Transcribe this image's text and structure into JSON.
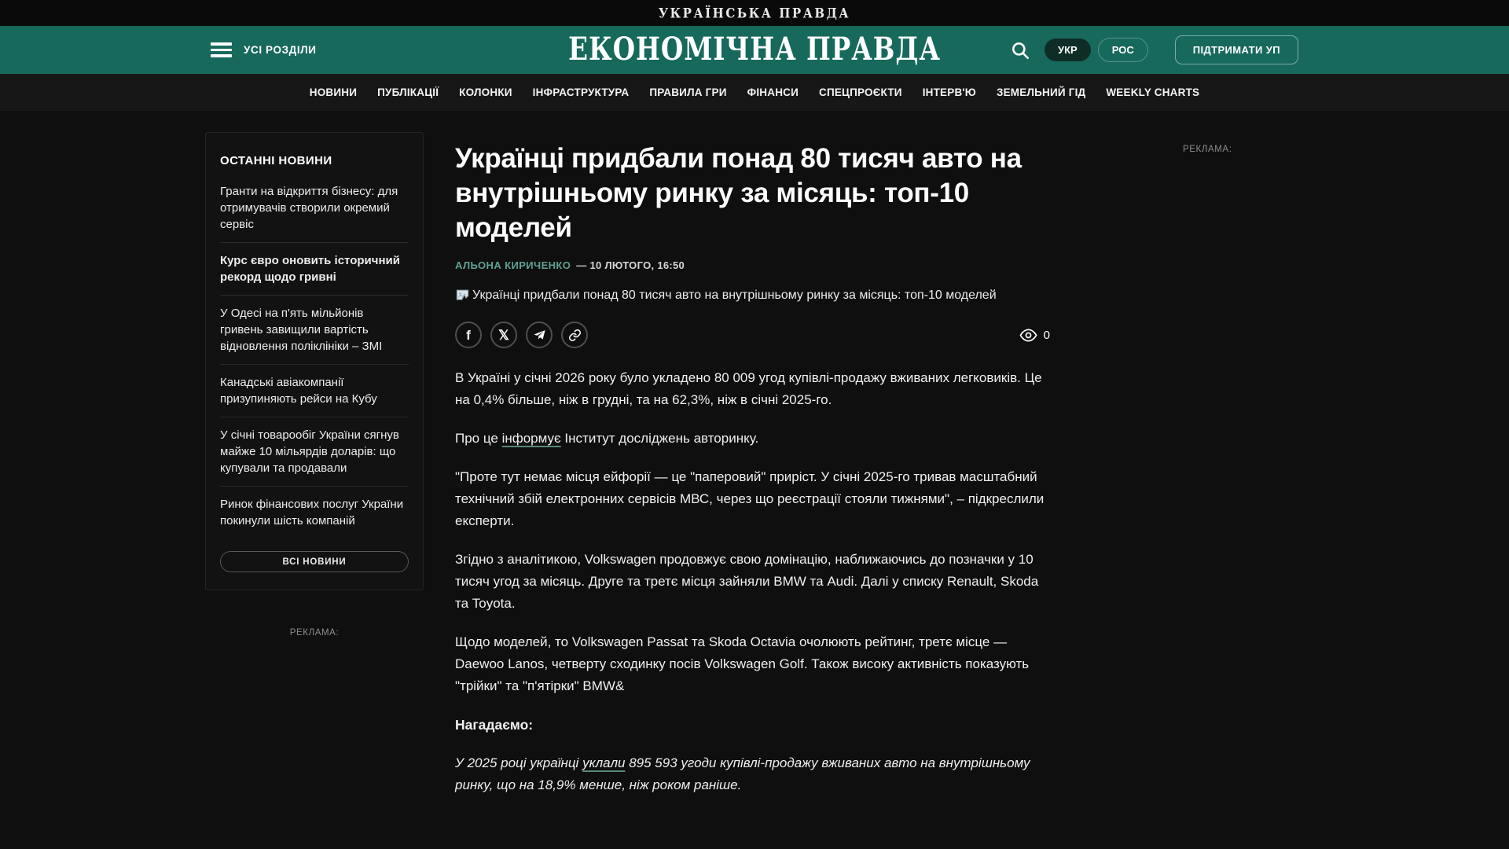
{
  "topbar": {
    "brand": "УКРАЇНСЬКА ПРАВДА"
  },
  "header": {
    "menu_label": "УСІ РОЗДІЛИ",
    "logo": "ЕКОНОМІЧНА ПРАВДА",
    "language_toggle": {
      "options": [
        {
          "label": "УКР",
          "active": true
        },
        {
          "label": "РОС",
          "active": false
        }
      ]
    },
    "support_button": "ПІДТРИМАТИ УП"
  },
  "nav": {
    "items": [
      "НОВИНИ",
      "ПУБЛІКАЦІЇ",
      "КОЛОНКИ",
      "ІНФРАСТРУКТУРА",
      "ПРАВИЛА ГРИ",
      "ФІНАНСИ",
      "СПЕЦПРОЄКТИ",
      "ІНТЕРВ'Ю",
      "ЗЕМЕЛЬНИЙ ГІД",
      "WEEKLY CHARTS"
    ]
  },
  "sidebar": {
    "title": "ОСТАННІ НОВИНИ",
    "items": [
      {
        "text": "Гранти на відкриття бізнесу: для отримувачів створили окремий сервіс",
        "bold": false
      },
      {
        "text": "Курс євро оновить історичний рекорд щодо гривні",
        "bold": true
      },
      {
        "text": "У Одесі на п'ять мільйонів гривень завищили вартість відновлення поліклініки – ЗМІ",
        "bold": false
      },
      {
        "text": "Канадські авіакомпанії призупиняють рейси на Кубу",
        "bold": false
      },
      {
        "text": "У січні товарообіг України сягнув майже 10 мільярдів доларів: що купували та продавали",
        "bold": false
      },
      {
        "text": "Ринок фінансових послуг України покинули шість компаній",
        "bold": false
      }
    ],
    "all_news_button": "ВСІ НОВИНИ",
    "ad_label": "РЕКЛАМА:"
  },
  "article": {
    "title": "Українці придбали понад 80 тисяч авто на внутрішньому ринку за місяць: топ-10 моделей",
    "author": "АЛЬОНА КИРИЧЕНКО",
    "date": "— 10 ЛЮТОГО, 16:50",
    "image_alt": "Українці придбали понад 80 тисяч авто на внутрішньому ринку за місяць: топ-10 моделей",
    "views": "0",
    "share_icons": [
      "facebook-icon",
      "x-twitter-icon",
      "telegram-icon",
      "copy-link-icon"
    ],
    "paragraphs": [
      {
        "style": "normal",
        "segments": [
          {
            "text": "В Україні у січні 2026 року було укладено 80 009 угод купівлі-продажу вживаних легковиків. Це на 0,4% більше, ніж в грудні, та на 62,3%, ніж в січні 2025-го."
          }
        ]
      },
      {
        "style": "normal",
        "segments": [
          {
            "text": "Про це "
          },
          {
            "text": "інформує",
            "link": true
          },
          {
            "text": " Інститут досліджень авторинку."
          }
        ]
      },
      {
        "style": "normal",
        "segments": [
          {
            "text": "\"Проте тут немає місця ейфорії — це \"паперовий\" приріст. У січні 2025-го тривав масштабний технічний збій електронних сервісів МВС, через що реєстрації стояли тижнями\", – підкреслили експерти."
          }
        ]
      },
      {
        "style": "normal",
        "segments": [
          {
            "text": "Згідно з аналітикою, Volkswagen продовжує свою домінацію, наближаючись до позначки у 10 тисяч угод за місяць. Друге та третє місця зайняли BMW та Audi. Далі у списку Renault, Skoda та Toyota."
          }
        ]
      },
      {
        "style": "normal",
        "segments": [
          {
            "text": "Щодо моделей, то Volkswagen Passat та Skoda Octavia очолюють рейтинг, третє місце — Daewoo Lanos, четверту сходинку посів Volkswagen Golf. Також високу активність показують \"трійки\" та \"п'ятірки\" BMW&"
          }
        ]
      },
      {
        "style": "bold",
        "segments": [
          {
            "text": "Нагадаємо:"
          }
        ]
      },
      {
        "style": "italic",
        "segments": [
          {
            "text": "У 2025 році українці "
          },
          {
            "text": "уклали",
            "link": true
          },
          {
            "text": " 895 593 угоди купівлі-продажу вживаних авто на внутрішньому ринку, що на 18,9% менше, ніж роком раніше."
          }
        ]
      }
    ]
  },
  "right_rail": {
    "ad_label": "РЕКЛАМА:"
  },
  "colors": {
    "header_teal": "#17695c",
    "page_background": "#0f0f0f",
    "nav_background": "#171717",
    "author_accent": "#5ea292",
    "link_underline": "#57897b",
    "muted_text": "#8d8d8d"
  }
}
